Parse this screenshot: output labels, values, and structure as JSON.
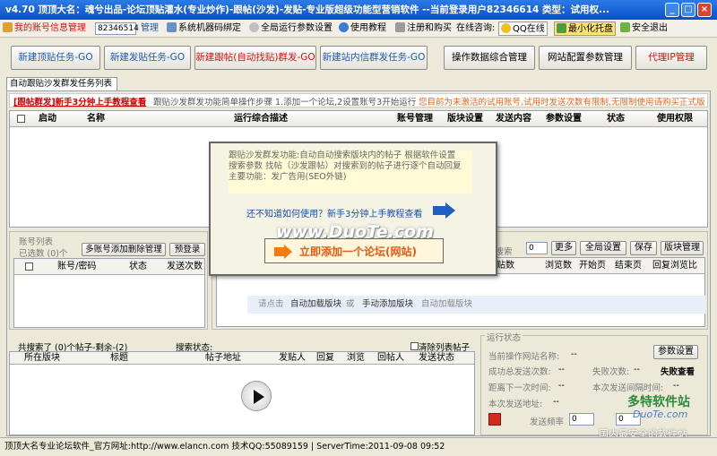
{
  "title": "v4.70 顶顶大名：魂兮出品-论坛顶贴灌水(专业炒作)-跟帖(沙发)-发贴-专业版超级功能型营销软件 --当前登录用户82346614 类型：试用权...",
  "toolbar": {
    "account_label": "我的账号信息管理",
    "account_value": "82346514",
    "manage": "管理",
    "machine_bind": "系统机器码绑定",
    "global_params": "全局运行参数设置",
    "tutorial": "使用教程",
    "register": "注册和购买",
    "online_consult": "在线咨询:",
    "qq_online": "QQ在线",
    "minimize_tray": "最小化托盘",
    "safe_exit": "安全退出"
  },
  "actions": {
    "new_top": "新建顶贴任务-GO",
    "new_post": "新建发贴任务-GO",
    "new_follow": "新建跟帖(自动找贴)群发-GO",
    "new_pm": "新建站内信群发任务-GO",
    "data_save": "操作数据综合管理",
    "site_config": "网站配置参数管理",
    "proxy_ip": "代理IP管理"
  },
  "tab": {
    "label": "自动跟贴沙发群发任务列表"
  },
  "notice": {
    "link": "[跟帖群发]新手3分钟上手教程查看",
    "steps": "跟贴沙发群发功能简单操作步骤 1.添加一个论坛,2设置账号3开始运行",
    "warning": "您目前为未激活的试用账号,试用时发送次数有限制,无限制使用请购买正式版"
  },
  "task_table": {
    "columns": [
      "启动",
      "名称",
      "运行综合描述",
      "账号管理",
      "版块设置",
      "发送内容",
      "参数设置",
      "状态",
      "使用权限"
    ]
  },
  "popup": {
    "desc1": "跟贴沙发群发功能:自动自动搜索版块内的帖子 根据软件设置",
    "desc2": "搜索参数 找帖（沙发跟帖）对搜索到的帖子进行逐个自动回复",
    "desc3": "主要功能：发广告用(SEO外链)",
    "how_to": "还不知道如何使用？新手3分钟上手教程查看",
    "add_forum": "立即添加一个论坛(网站)",
    "watermark": "www.DuoTe.com"
  },
  "accounts": {
    "title": "账号列表",
    "selected": "已选数 (0)个",
    "multi_btn": "多账号添加删除管理",
    "preview_btn": "预登录",
    "columns": [
      "账号/密码",
      "状态",
      "发送次数"
    ]
  },
  "boards": {
    "search_label": "大搜索",
    "search_value": "0",
    "more": "更多",
    "global_settings": "全局设置",
    "save": "保存",
    "board_manage": "版块管理",
    "columns": [
      "贴数",
      "浏览数",
      "开始页",
      "结束页",
      "回复浏览比"
    ],
    "hint_click": "请点击",
    "auto_load": "自动加载版块",
    "or": "或",
    "manual_add": "手动添加版块",
    "auto_load2": "自动加载版块"
  },
  "posts": {
    "found": "共搜索了 (0)个帖子-剩余-(2)",
    "search_status": "搜索状态:",
    "clear_list": "清除列表帖子",
    "columns": [
      "所在版块",
      "标题",
      "帖子地址",
      "发贴人",
      "回复",
      "浏览",
      "回帖人",
      "发送状态"
    ]
  },
  "run_status": {
    "title": "运行状态",
    "current_site": "当前操作网站名称:",
    "current_site_value": "--",
    "params_btn": "参数设置",
    "success_count": "成功总发送次数:",
    "success_value": "--",
    "fail_count": "失败次数:",
    "fail_value": "--",
    "fail_view": "失败查看",
    "next_time": "距离下一次时间:",
    "next_value": "--",
    "interval": "本次发送间隔时间:",
    "interval_value": "--",
    "current_address": "本次发送地址:",
    "address_value": "--",
    "frequency": "发送频率",
    "freq_value": "0",
    "freq_value2": "0"
  },
  "watermark2": {
    "brand": "多特软件站",
    "site": "DuoTe.com",
    "slogan": "国内最安全的软件站"
  },
  "statusbar": "顶顶大名专业论坛软件_官方网址:http://www.elancn.com 技术QQ:55089159 | ServerTime:2011-09-08 09:52"
}
